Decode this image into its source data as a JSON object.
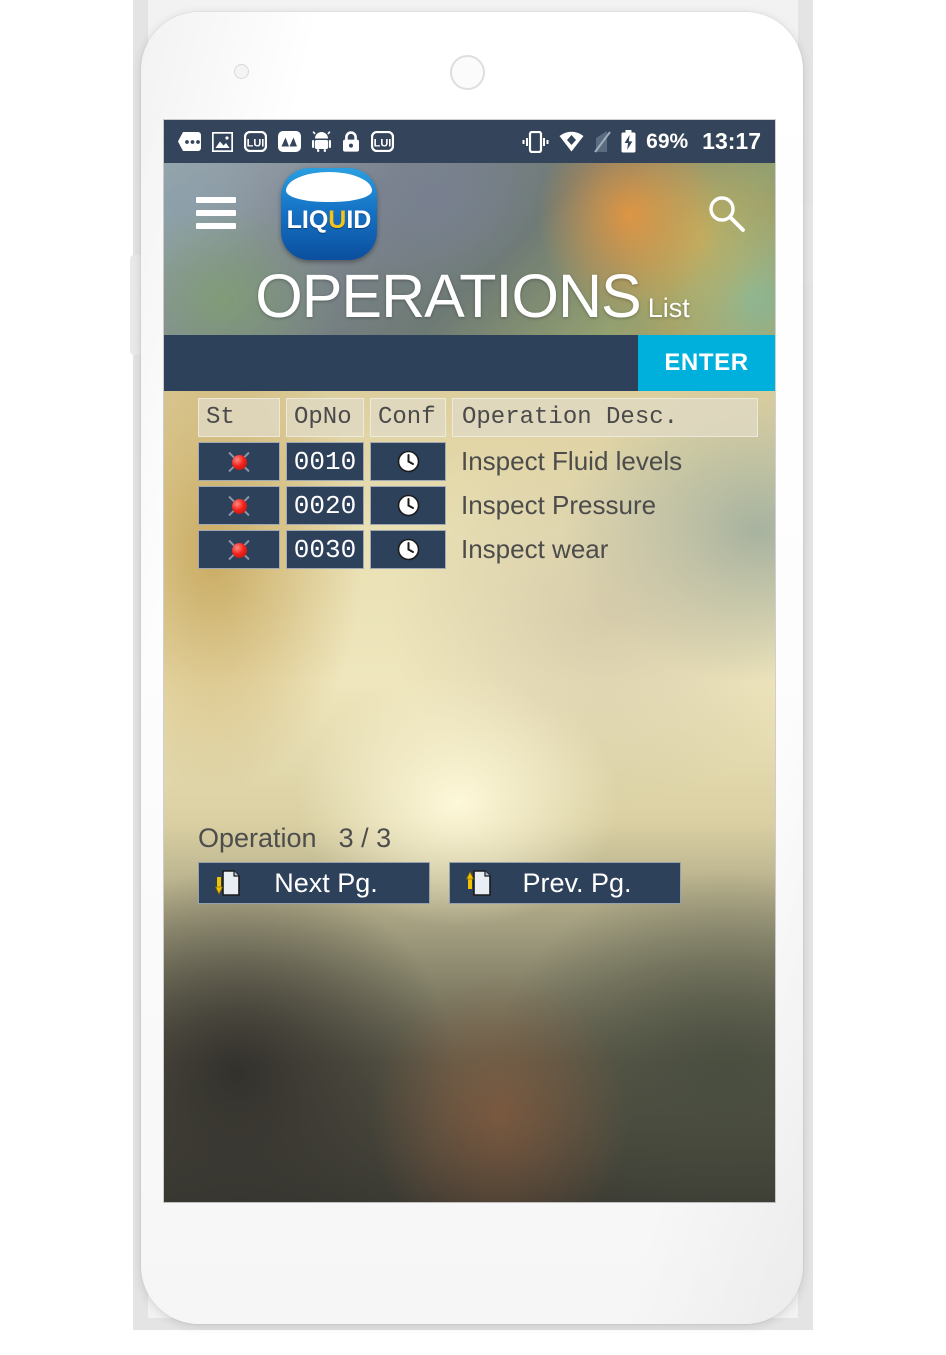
{
  "statusbar": {
    "icons_left": [
      "messages-icon",
      "photo-icon",
      "liquid-app-icon",
      "peaks-app-icon",
      "android-icon",
      "lock-icon",
      "liquid-app-icon-2"
    ],
    "icons_right": [
      "vibrate-icon",
      "wifi-icon",
      "no-signal-icon",
      "battery-charging-icon"
    ],
    "battery_percent": "69%",
    "clock": "13:17"
  },
  "header": {
    "menu_icon": "hamburger-icon",
    "logo_text_pre": "LIQ",
    "logo_text_u": "U",
    "logo_text_post": "ID",
    "search_icon": "search-icon",
    "title": "OPERATIONS",
    "subtitle": "List"
  },
  "actionbar": {
    "enter_label": "ENTER"
  },
  "table": {
    "headers": {
      "status": "St",
      "opno": "OpNo",
      "conf": "Conf",
      "desc": "Operation Desc."
    },
    "rows": [
      {
        "status_icon": "red-light-icon",
        "opno": "0010",
        "conf_icon": "clock-icon",
        "desc": "Inspect Fluid levels"
      },
      {
        "status_icon": "red-light-icon",
        "opno": "0020",
        "conf_icon": "clock-icon",
        "desc": "Inspect Pressure"
      },
      {
        "status_icon": "red-light-icon",
        "opno": "0030",
        "conf_icon": "clock-icon",
        "desc": "Inspect wear"
      }
    ]
  },
  "footer": {
    "counter_label": "Operation",
    "counter_value": "3 / 3",
    "next_label": "Next Pg.",
    "next_icon": "page-down-icon",
    "prev_label": "Prev. Pg.",
    "prev_icon": "page-up-icon"
  },
  "colors": {
    "accent_cyan": "#00b0dc",
    "navy": "#2e415a",
    "statusbar_navy": "#34445a",
    "led_red": "#f2231b",
    "arrow_yellow": "#f2c200"
  }
}
